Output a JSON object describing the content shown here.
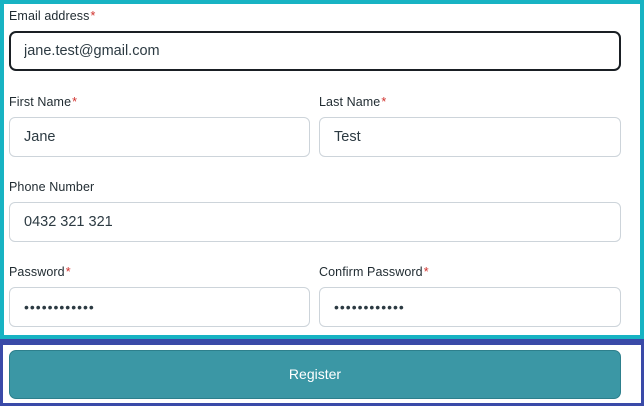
{
  "form": {
    "email": {
      "label": "Email address",
      "required_mark": "*",
      "value": "jane.test@gmail.com"
    },
    "first_name": {
      "label": "First Name",
      "required_mark": "*",
      "value": "Jane"
    },
    "last_name": {
      "label": "Last Name",
      "required_mark": "*",
      "value": "Test"
    },
    "phone": {
      "label": "Phone Number",
      "value": "0432 321 321"
    },
    "password": {
      "label": "Password",
      "required_mark": "*",
      "value": "••••••••••••"
    },
    "confirm_password": {
      "label": "Confirm Password",
      "required_mark": "*",
      "value": "••••••••••••"
    }
  },
  "register_button": {
    "label": "Register"
  },
  "colors": {
    "form_outline": "#17b3c3",
    "button_outline": "#3a4aa8",
    "button_fill": "#3b97a5",
    "required_mark": "#d0312d"
  }
}
